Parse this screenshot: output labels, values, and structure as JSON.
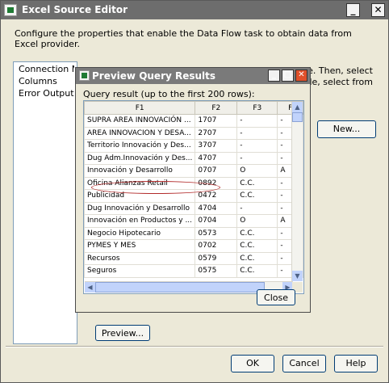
{
  "window": {
    "title": "Excel Source Editor",
    "description": "Configure the properties that enable the Data Flow task to obtain data from Excel provider.",
    "partial_text_line1": "source. Then, select",
    "partial_text_line2": "s mode, select from",
    "nav_items": [
      "Connection Manager",
      "Columns",
      "Error Output"
    ],
    "new_button": "New...",
    "preview_button": "Preview...",
    "ok_button": "OK",
    "cancel_button": "Cancel",
    "help_button": "Help"
  },
  "dialog": {
    "title": "Preview Query Results",
    "query_label": "Query result (up to the first 200 rows):",
    "close_button": "Close",
    "columns": [
      "F1",
      "F2",
      "F3",
      "F"
    ],
    "rows": [
      [
        "SUPRA AREA INNOVACIÓN ...",
        "1707",
        "-",
        "-"
      ],
      [
        "AREA INNOVACION Y DESA...",
        "2707",
        "-",
        "-"
      ],
      [
        "Territorio Innovación y Des...",
        "3707",
        "-",
        "-"
      ],
      [
        "Dug Adm.Innovación y Des...",
        "4707",
        "-",
        "-"
      ],
      [
        "Innovación y Desarrollo",
        "0707",
        "O",
        "A"
      ],
      [
        "Oficina Alianzas Retail",
        "0892",
        "C.C.",
        "-"
      ],
      [
        "Publicidad",
        "0472",
        "C.C.",
        "-"
      ],
      [
        "Dug Innovación y Desarrollo",
        "4704",
        "-",
        "-"
      ],
      [
        "Innovación en Productos y ...",
        "0704",
        "O",
        "A"
      ],
      [
        "Negocio Hipotecario",
        "0573",
        "C.C.",
        "-"
      ],
      [
        "PYMES Y MES",
        "0702",
        "C.C.",
        "-"
      ],
      [
        "Recursos",
        "0579",
        "C.C.",
        "-"
      ],
      [
        "Seguros",
        "0575",
        "C.C.",
        "-"
      ]
    ]
  }
}
